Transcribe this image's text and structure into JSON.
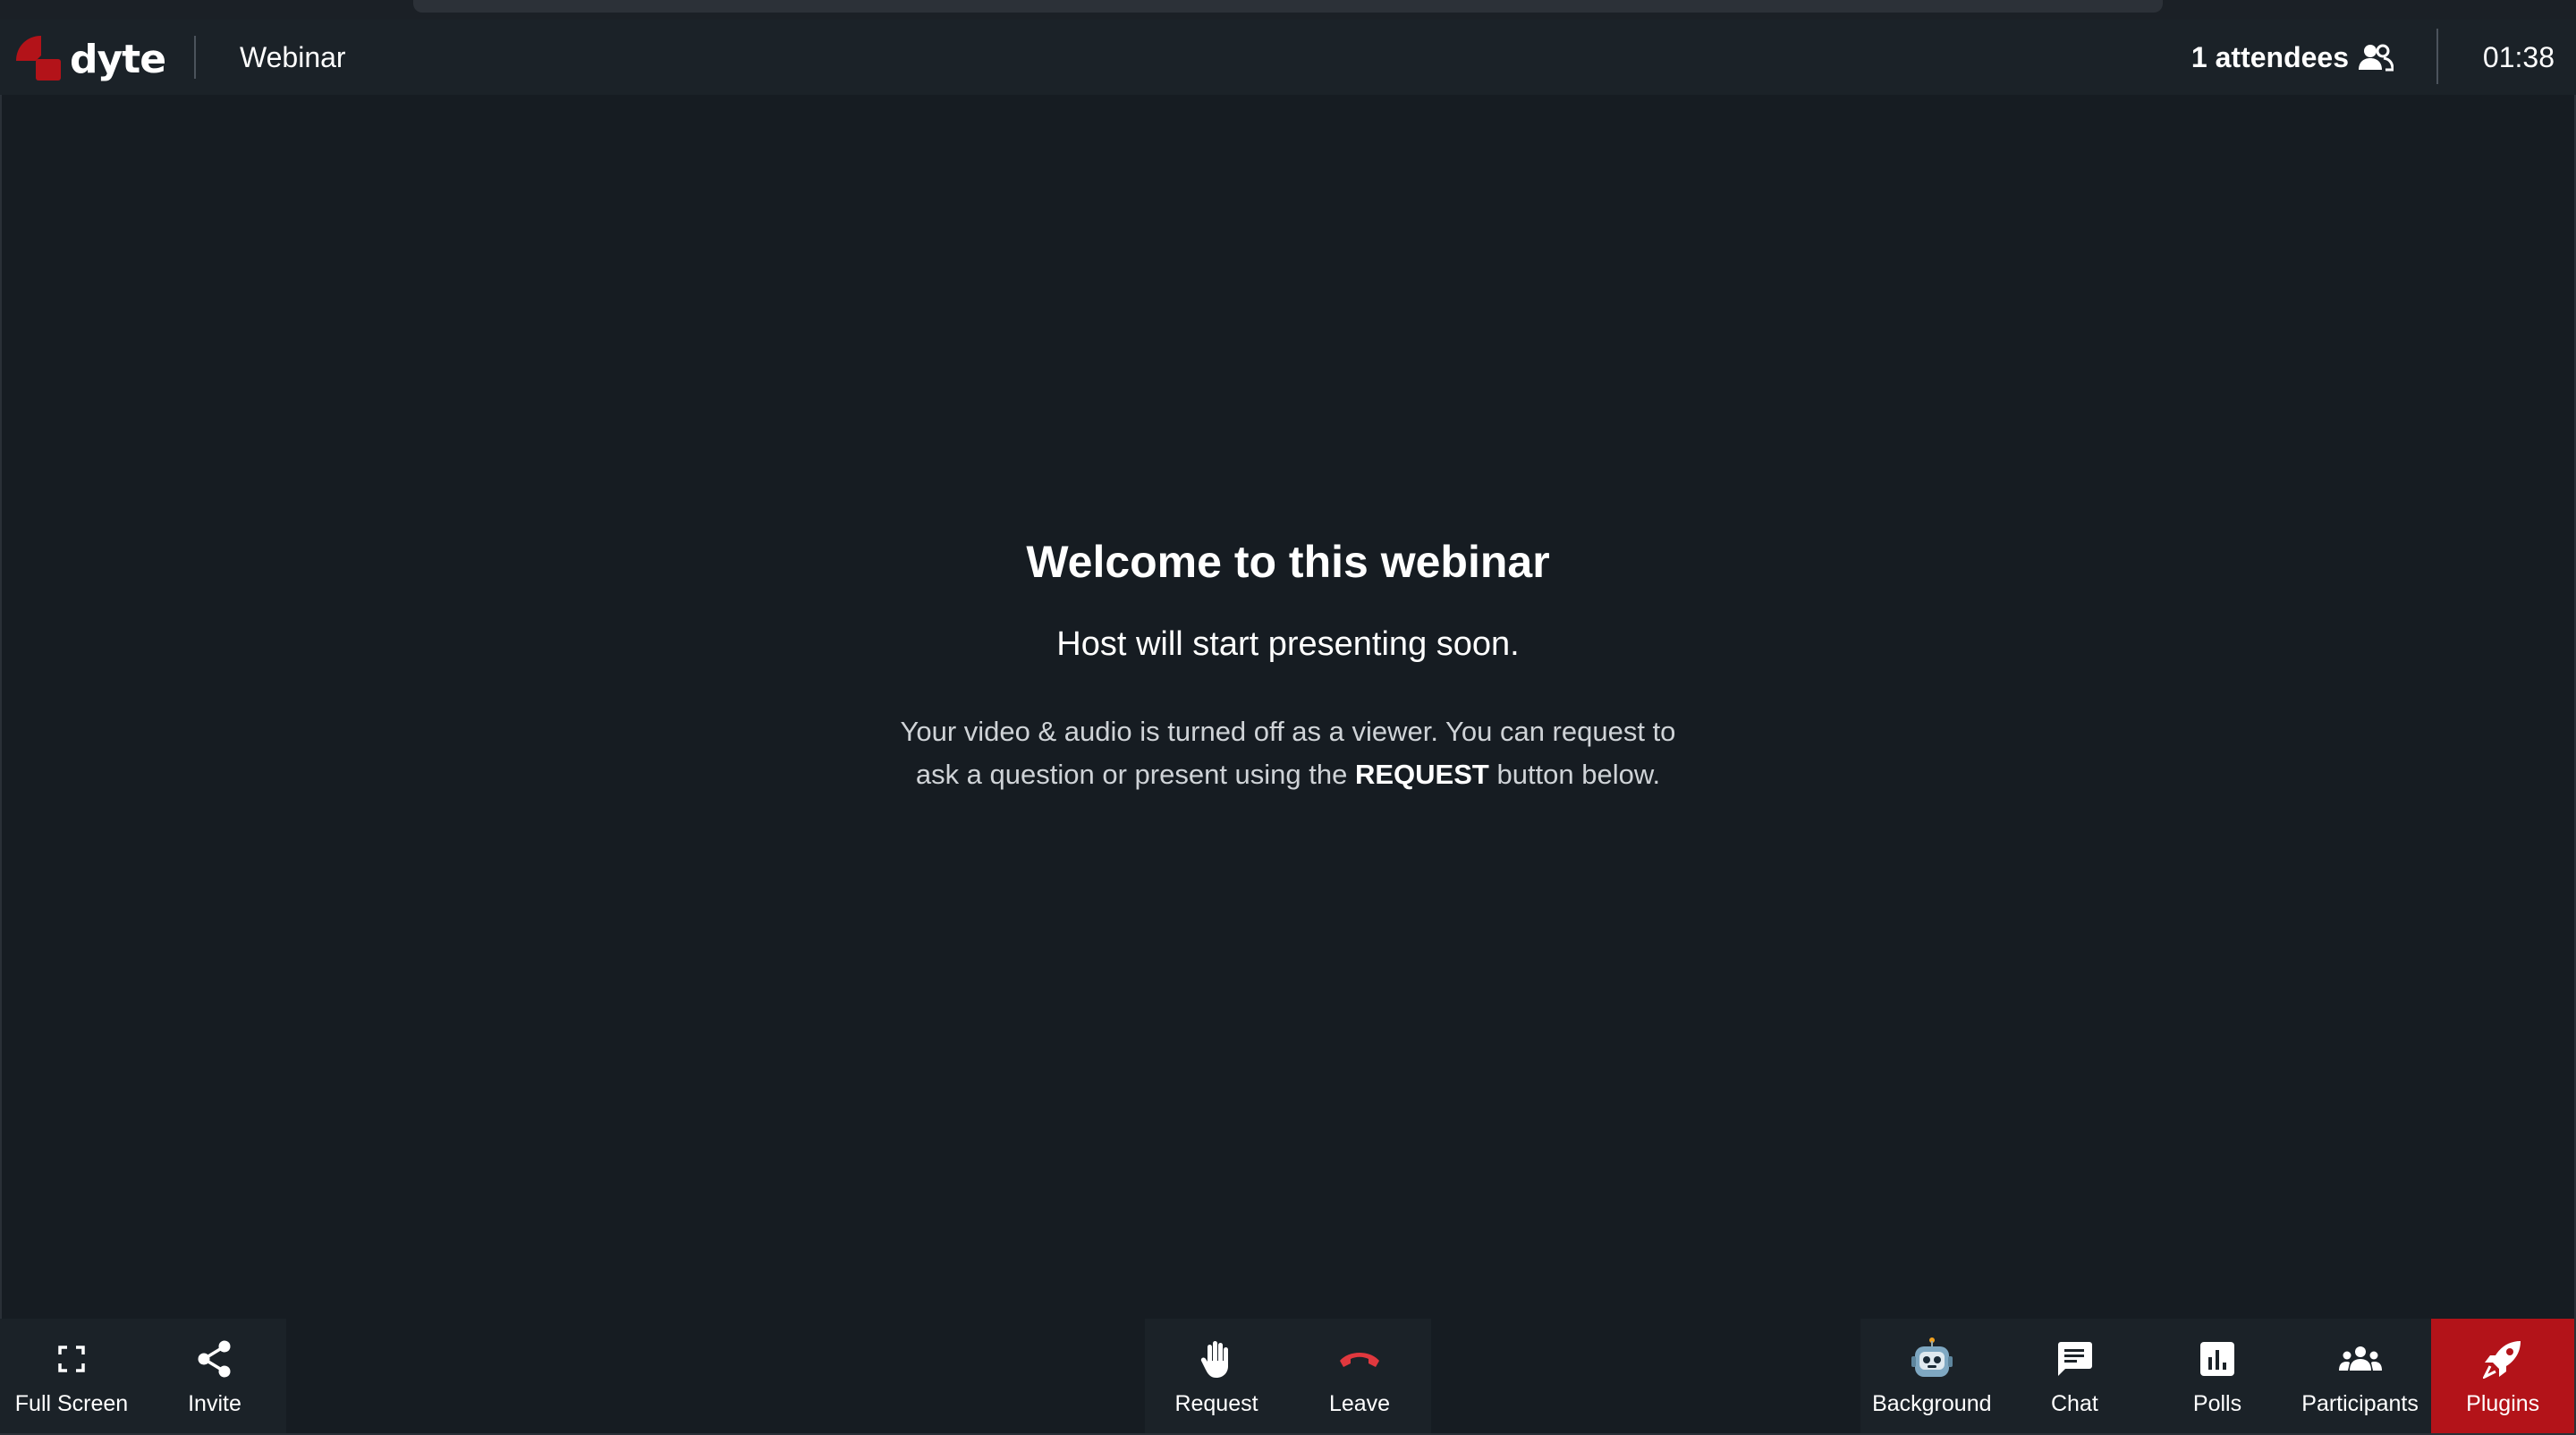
{
  "app": {
    "brand": "dyte",
    "meeting_title": "Webinar"
  },
  "header": {
    "attendees_label": "1 attendees",
    "clock": "01:38"
  },
  "stage": {
    "title": "Welcome to this webinar",
    "subtitle": "Host will start presenting soon.",
    "desc_line1": "Your video & audio is turned off as a viewer. You can request to",
    "desc_line2_pre": "ask a question or present using the ",
    "desc_line2_bold": "REQUEST",
    "desc_line2_post": " button below."
  },
  "controls": {
    "left": [
      {
        "label": "Full Screen",
        "icon": "fullscreen-icon"
      },
      {
        "label": "Invite",
        "icon": "share-icon"
      }
    ],
    "center": [
      {
        "label": "Request",
        "icon": "hand-icon"
      },
      {
        "label": "Leave",
        "icon": "hangup-icon"
      }
    ],
    "right": [
      {
        "label": "Background",
        "icon": "robot-icon"
      },
      {
        "label": "Chat",
        "icon": "chat-icon"
      },
      {
        "label": "Polls",
        "icon": "poll-icon"
      },
      {
        "label": "Participants",
        "icon": "participants-icon"
      },
      {
        "label": "Plugins",
        "icon": "rocket-icon"
      }
    ]
  },
  "colors": {
    "background": "#161c22",
    "bar": "#1b2228",
    "accent": "#b31319",
    "leave": "#e0383e"
  }
}
